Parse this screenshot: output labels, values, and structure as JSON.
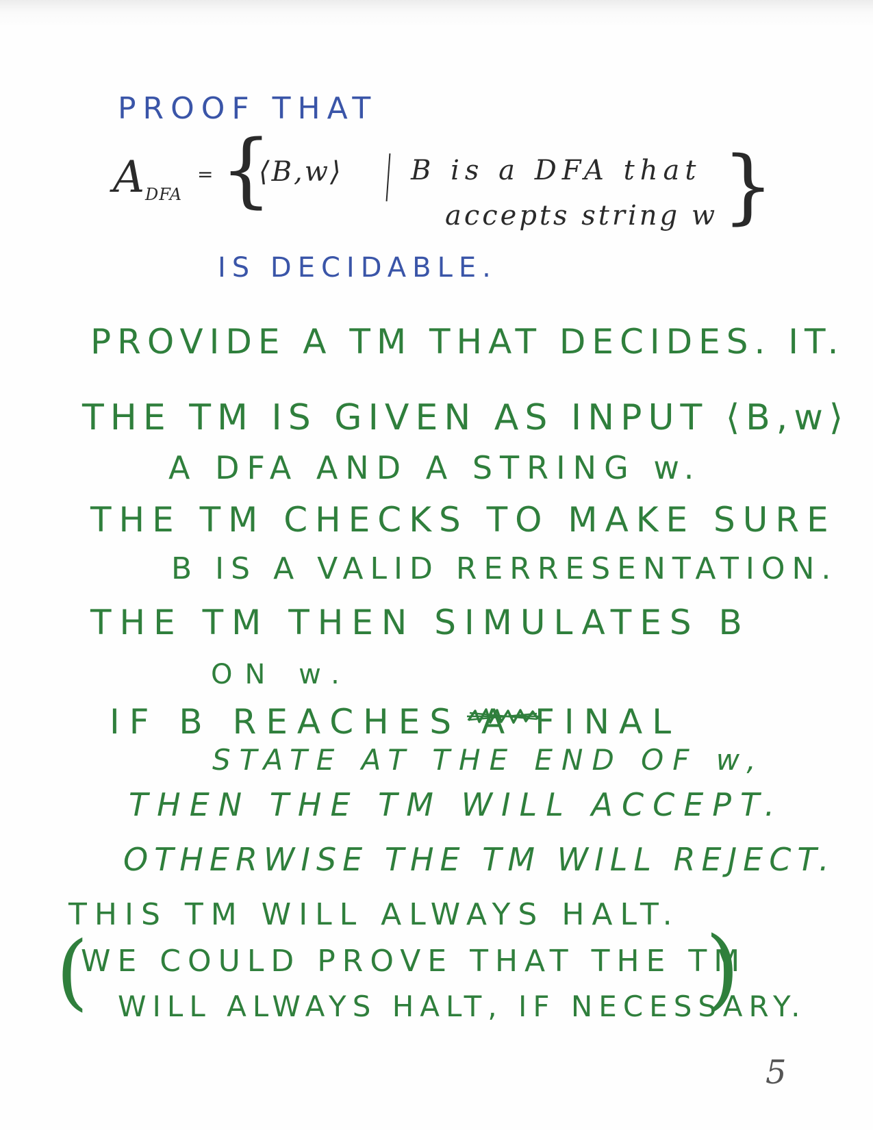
{
  "title": {
    "line1": "PROOF THAT",
    "is_decidable": "IS DECIDABLE."
  },
  "definition": {
    "symbol": "A",
    "subscript": "DFA",
    "equals": "=",
    "open_brace": "{",
    "pair": "⟨B,w⟩",
    "condition_line1": "B is a DFA that",
    "condition_line2": "accepts string w",
    "close_brace": "}"
  },
  "proof_lines": [
    "PROVIDE A TM THAT DECIDES. IT.",
    "THE TM IS GIVEN AS INPUT ⟨B,w⟩",
    "A DFA AND A STRING w.",
    "THE TM CHECKS TO MAKE SURE",
    "B IS A VALID RERRESENTATION.",
    "THE TM THEN SIMULATES B",
    "ON w.",
    "IF B REACHES A FINAL",
    "STATE AT THE END OF w,",
    "THEN THE TM WILL ACCEPT.",
    "OTHERWISE THE TM WILL REJECT.",
    "THIS TM WILL ALWAYS HALT.",
    "WE COULD PROVE THAT THE TM",
    "WILL ALWAYS HALT, IF NECESSARY."
  ],
  "parens": {
    "open": "(",
    "close": ")"
  },
  "page_number": "5",
  "colors": {
    "blue_ink": "#3a55a8",
    "green_ink": "#2f7f3c",
    "black_ink": "#2a2a2a",
    "paper": "#fefefe"
  }
}
